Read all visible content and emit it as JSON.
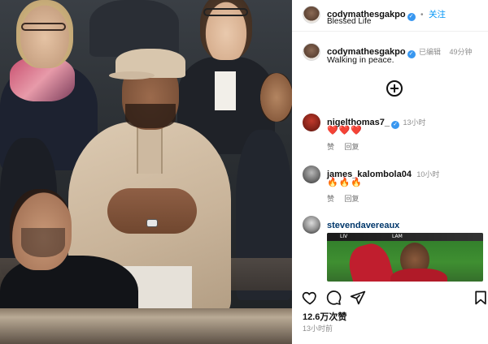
{
  "post": {
    "author": "codymathesgakpo",
    "follow_label": "关注",
    "audio": "Blessed Life",
    "caption_author": "codymathesgakpo",
    "edited_label": "已编辑",
    "caption_time": "49分钟",
    "caption": "Walking in peace.",
    "likes": "12.6万次赞",
    "posted_ago": "13小时前"
  },
  "comments": [
    {
      "user": "nigelthomas7_",
      "verified": true,
      "time": "13小时",
      "text": "❤️❤️❤️",
      "like_label": "赞",
      "reply_label": "回复"
    },
    {
      "user": "james_kalombola04",
      "verified": false,
      "time": "10小时",
      "text": "🔥🔥🔥",
      "like_label": "赞",
      "reply_label": "回复"
    },
    {
      "user": "stevendavereaux",
      "verified": false,
      "time": "",
      "text": "",
      "like_label": "",
      "reply_label": ""
    }
  ],
  "scoreboard": {
    "home": "LIV",
    "away": "LAM"
  },
  "icons": {
    "verified": "verified-badge-icon",
    "add_comment": "plus-circle-icon",
    "like": "heart-icon",
    "comment": "comment-bubble-icon",
    "share": "paper-plane-icon",
    "save": "bookmark-icon"
  },
  "colors": {
    "accent": "#0095f6",
    "verified": "#3897f0",
    "heart": "#e0245e"
  }
}
